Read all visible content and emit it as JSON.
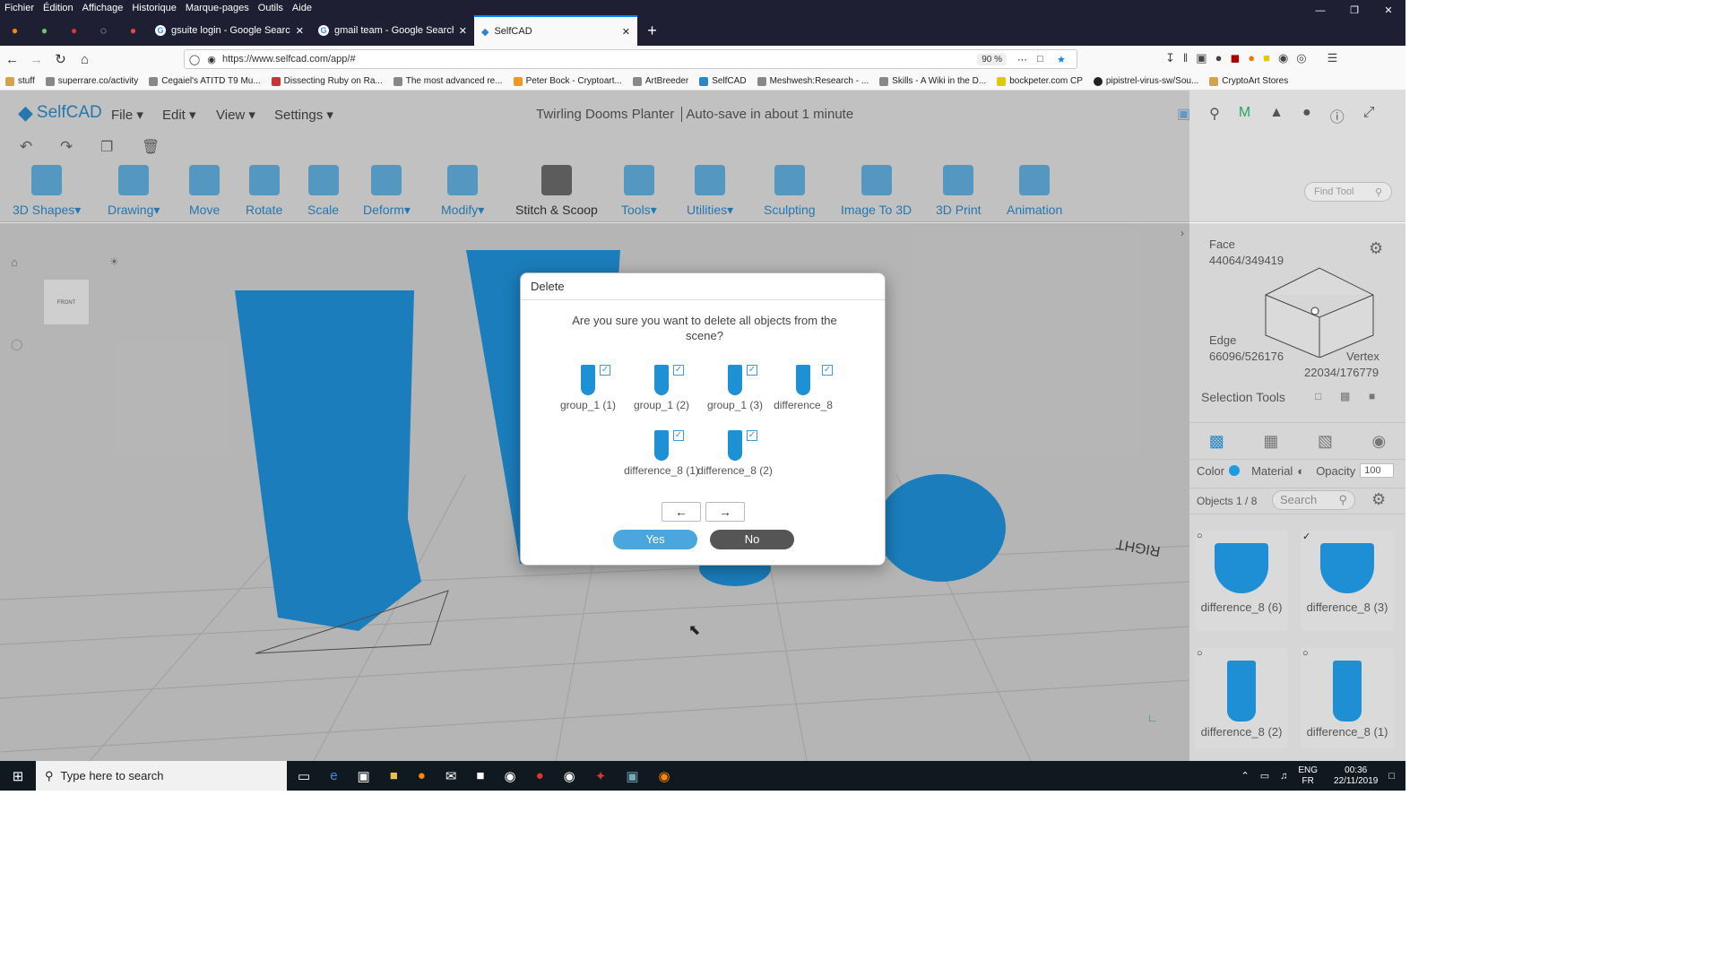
{
  "firefox": {
    "menu": [
      "Fichier",
      "Édition",
      "Affichage",
      "Historique",
      "Marque-pages",
      "Outils",
      "Aide"
    ],
    "tabs": [
      {
        "title": "gsuite login - Google Search"
      },
      {
        "title": "gmail team - Google Search"
      },
      {
        "title": "SelfCAD"
      }
    ],
    "new_tab": "+",
    "url": "https://www.selfcad.com/app/#",
    "zoom": "90 %",
    "bookmarks": [
      "stuff",
      "superrare.co/activity",
      "Cegaiel's ATITD T9 Mu...",
      "Dissecting Ruby on Ra...",
      "The most advanced re...",
      "Peter Bock - Cryptoart...",
      "ArtBreeder",
      "SelfCAD",
      "Meshwesh:Research - ...",
      "Skills - A Wiki in the D...",
      "bockpeter.com CP",
      "pipistrel-virus-sw/Sou...",
      "CryptoArt Stores"
    ]
  },
  "app": {
    "logo": "SelfCAD",
    "menus": [
      "File",
      "Edit",
      "View",
      "Settings"
    ],
    "project_title": "Twirling Dooms Planter",
    "autosave": "Auto-save in about 1 minute",
    "find_tool_placeholder": "Find Tool",
    "tools": [
      {
        "label": "3D Shapes",
        "dropdown": true
      },
      {
        "label": "Drawing",
        "dropdown": true
      },
      {
        "label": "Move",
        "dropdown": false
      },
      {
        "label": "Rotate",
        "dropdown": false
      },
      {
        "label": "Scale",
        "dropdown": false
      },
      {
        "label": "Deform",
        "dropdown": true
      },
      {
        "label": "Modify",
        "dropdown": true
      },
      {
        "label": "Stitch & Scoop",
        "dropdown": false
      },
      {
        "label": "Tools",
        "dropdown": true
      },
      {
        "label": "Utilities",
        "dropdown": true
      },
      {
        "label": "Sculpting",
        "dropdown": false
      },
      {
        "label": "Image To 3D",
        "dropdown": false
      },
      {
        "label": "3D Print",
        "dropdown": false
      },
      {
        "label": "Animation",
        "dropdown": false
      }
    ],
    "viewcube_label": "FRONT",
    "ground_label": "RIGHT"
  },
  "panel": {
    "face_label": "Face",
    "face_value": "44064/349419",
    "edge_label": "Edge",
    "edge_value": "66096/526176",
    "vertex_label": "Vertex",
    "vertex_value": "22034/176779",
    "selection_tools": "Selection Tools",
    "color_label": "Color",
    "color": "#1e9be0",
    "material_label": "Material",
    "opacity_label": "Opacity",
    "opacity_value": "100",
    "objects_count": "Objects 1 / 8",
    "search_placeholder": "Search",
    "objects": [
      {
        "name": "difference_8 (6)",
        "checked": false
      },
      {
        "name": "difference_8 (3)",
        "checked": true
      },
      {
        "name": "difference_8 (2)",
        "checked": false
      },
      {
        "name": "difference_8 (1)",
        "checked": false
      }
    ]
  },
  "dialog": {
    "title": "Delete",
    "message": "Are you sure you want to delete all objects from the scene?",
    "items": [
      {
        "name": "group_1 (1)",
        "checked": true
      },
      {
        "name": "group_1 (2)",
        "checked": true
      },
      {
        "name": "group_1 (3)",
        "checked": true
      },
      {
        "name": "difference_8",
        "checked": true
      },
      {
        "name": "difference_8 (1)",
        "checked": true
      },
      {
        "name": "difference_8 (2)",
        "checked": true
      }
    ],
    "prev": "←",
    "next": "→",
    "yes": "Yes",
    "no": "No"
  },
  "taskbar": {
    "search_placeholder": "Type here to search",
    "lang1": "ENG",
    "lang2": "FR",
    "time": "00:36",
    "date": "22/11/2019"
  },
  "colors": {
    "accent": "#2d87c7",
    "object_blue": "#1e90d6",
    "yes": "#4aa6dd",
    "no": "#555555"
  }
}
